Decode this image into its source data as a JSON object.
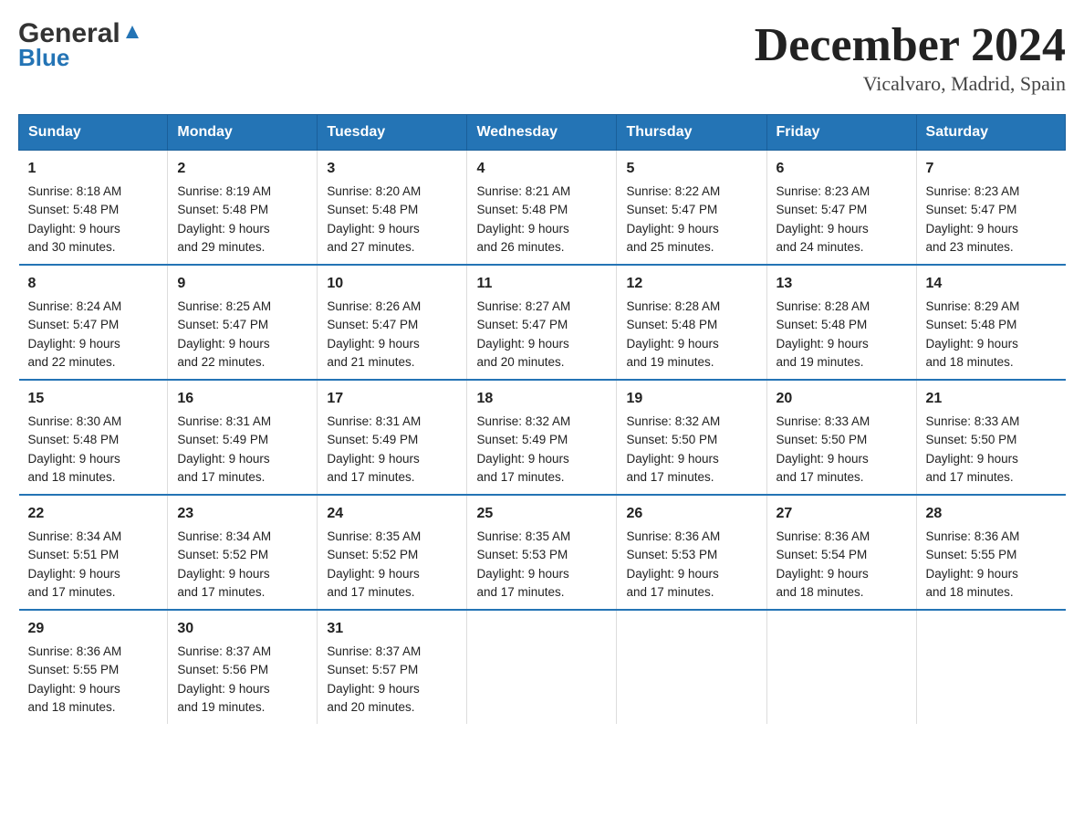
{
  "logo": {
    "general": "General",
    "blue": "Blue"
  },
  "title": "December 2024",
  "subtitle": "Vicalvaro, Madrid, Spain",
  "days_of_week": [
    "Sunday",
    "Monday",
    "Tuesday",
    "Wednesday",
    "Thursday",
    "Friday",
    "Saturday"
  ],
  "weeks": [
    [
      {
        "num": "1",
        "sunrise": "8:18 AM",
        "sunset": "5:48 PM",
        "daylight": "9 hours and 30 minutes."
      },
      {
        "num": "2",
        "sunrise": "8:19 AM",
        "sunset": "5:48 PM",
        "daylight": "9 hours and 29 minutes."
      },
      {
        "num": "3",
        "sunrise": "8:20 AM",
        "sunset": "5:48 PM",
        "daylight": "9 hours and 27 minutes."
      },
      {
        "num": "4",
        "sunrise": "8:21 AM",
        "sunset": "5:48 PM",
        "daylight": "9 hours and 26 minutes."
      },
      {
        "num": "5",
        "sunrise": "8:22 AM",
        "sunset": "5:47 PM",
        "daylight": "9 hours and 25 minutes."
      },
      {
        "num": "6",
        "sunrise": "8:23 AM",
        "sunset": "5:47 PM",
        "daylight": "9 hours and 24 minutes."
      },
      {
        "num": "7",
        "sunrise": "8:23 AM",
        "sunset": "5:47 PM",
        "daylight": "9 hours and 23 minutes."
      }
    ],
    [
      {
        "num": "8",
        "sunrise": "8:24 AM",
        "sunset": "5:47 PM",
        "daylight": "9 hours and 22 minutes."
      },
      {
        "num": "9",
        "sunrise": "8:25 AM",
        "sunset": "5:47 PM",
        "daylight": "9 hours and 22 minutes."
      },
      {
        "num": "10",
        "sunrise": "8:26 AM",
        "sunset": "5:47 PM",
        "daylight": "9 hours and 21 minutes."
      },
      {
        "num": "11",
        "sunrise": "8:27 AM",
        "sunset": "5:47 PM",
        "daylight": "9 hours and 20 minutes."
      },
      {
        "num": "12",
        "sunrise": "8:28 AM",
        "sunset": "5:48 PM",
        "daylight": "9 hours and 19 minutes."
      },
      {
        "num": "13",
        "sunrise": "8:28 AM",
        "sunset": "5:48 PM",
        "daylight": "9 hours and 19 minutes."
      },
      {
        "num": "14",
        "sunrise": "8:29 AM",
        "sunset": "5:48 PM",
        "daylight": "9 hours and 18 minutes."
      }
    ],
    [
      {
        "num": "15",
        "sunrise": "8:30 AM",
        "sunset": "5:48 PM",
        "daylight": "9 hours and 18 minutes."
      },
      {
        "num": "16",
        "sunrise": "8:31 AM",
        "sunset": "5:49 PM",
        "daylight": "9 hours and 17 minutes."
      },
      {
        "num": "17",
        "sunrise": "8:31 AM",
        "sunset": "5:49 PM",
        "daylight": "9 hours and 17 minutes."
      },
      {
        "num": "18",
        "sunrise": "8:32 AM",
        "sunset": "5:49 PM",
        "daylight": "9 hours and 17 minutes."
      },
      {
        "num": "19",
        "sunrise": "8:32 AM",
        "sunset": "5:50 PM",
        "daylight": "9 hours and 17 minutes."
      },
      {
        "num": "20",
        "sunrise": "8:33 AM",
        "sunset": "5:50 PM",
        "daylight": "9 hours and 17 minutes."
      },
      {
        "num": "21",
        "sunrise": "8:33 AM",
        "sunset": "5:50 PM",
        "daylight": "9 hours and 17 minutes."
      }
    ],
    [
      {
        "num": "22",
        "sunrise": "8:34 AM",
        "sunset": "5:51 PM",
        "daylight": "9 hours and 17 minutes."
      },
      {
        "num": "23",
        "sunrise": "8:34 AM",
        "sunset": "5:52 PM",
        "daylight": "9 hours and 17 minutes."
      },
      {
        "num": "24",
        "sunrise": "8:35 AM",
        "sunset": "5:52 PM",
        "daylight": "9 hours and 17 minutes."
      },
      {
        "num": "25",
        "sunrise": "8:35 AM",
        "sunset": "5:53 PM",
        "daylight": "9 hours and 17 minutes."
      },
      {
        "num": "26",
        "sunrise": "8:36 AM",
        "sunset": "5:53 PM",
        "daylight": "9 hours and 17 minutes."
      },
      {
        "num": "27",
        "sunrise": "8:36 AM",
        "sunset": "5:54 PM",
        "daylight": "9 hours and 18 minutes."
      },
      {
        "num": "28",
        "sunrise": "8:36 AM",
        "sunset": "5:55 PM",
        "daylight": "9 hours and 18 minutes."
      }
    ],
    [
      {
        "num": "29",
        "sunrise": "8:36 AM",
        "sunset": "5:55 PM",
        "daylight": "9 hours and 18 minutes."
      },
      {
        "num": "30",
        "sunrise": "8:37 AM",
        "sunset": "5:56 PM",
        "daylight": "9 hours and 19 minutes."
      },
      {
        "num": "31",
        "sunrise": "8:37 AM",
        "sunset": "5:57 PM",
        "daylight": "9 hours and 20 minutes."
      },
      null,
      null,
      null,
      null
    ]
  ]
}
